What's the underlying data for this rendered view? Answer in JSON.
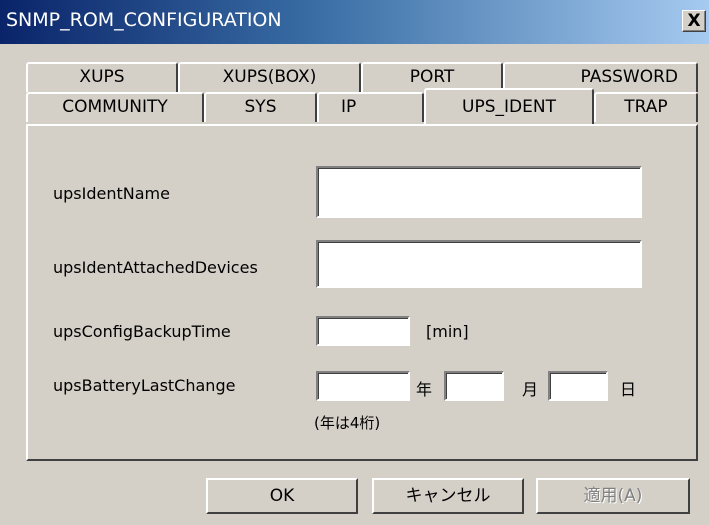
{
  "window": {
    "title": "SNMP_ROM_CONFIGURATION",
    "close_label": "X"
  },
  "tabs": {
    "row1": [
      "XUPS",
      "XUPS(BOX)",
      "PORT",
      "PASSWORD"
    ],
    "row2": [
      "COMMUNITY",
      "SYS",
      "IP",
      "UPS_IDENT",
      "TRAP"
    ],
    "active": "UPS_IDENT"
  },
  "form": {
    "ident_name": {
      "label": "upsIdentName",
      "value": ""
    },
    "attached_devices": {
      "label": "upsIdentAttachedDevices",
      "value": ""
    },
    "backup_time": {
      "label": "upsConfigBackupTime",
      "value": "",
      "unit": "[min]"
    },
    "battery_last_change": {
      "label": "upsBatteryLastChange",
      "year_value": "",
      "year_unit": "年",
      "month_value": "",
      "month_unit": "月",
      "day_value": "",
      "day_unit": "日",
      "note": "(年は4桁)"
    }
  },
  "buttons": {
    "ok": "OK",
    "cancel": "キャンセル",
    "apply": "適用(A)"
  }
}
